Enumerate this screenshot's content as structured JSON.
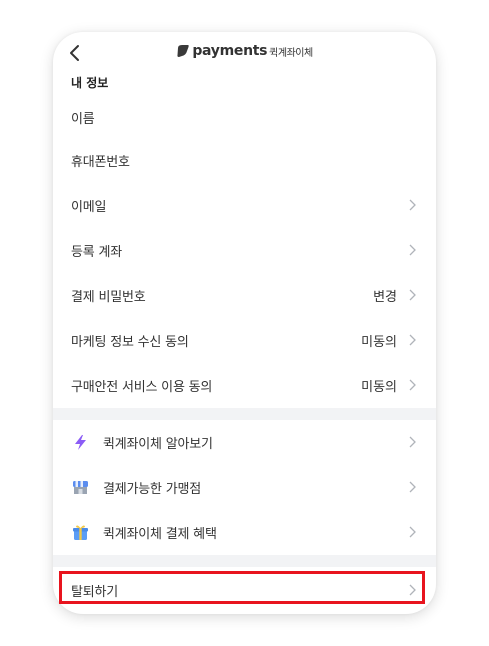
{
  "header": {
    "back_icon": "chevron-left-icon",
    "brand_word": "payments",
    "brand_sub": "퀵계좌이체"
  },
  "section_title": "내 정보",
  "info_rows": [
    {
      "label": "이름",
      "value": "",
      "chevron": false
    },
    {
      "label": "휴대폰번호",
      "value": "",
      "chevron": false
    },
    {
      "label": "이메일",
      "value": "",
      "chevron": true
    },
    {
      "label": "등록 계좌",
      "value": "",
      "chevron": true
    },
    {
      "label": "결제 비밀번호",
      "value": "변경",
      "chevron": true
    },
    {
      "label": "마케팅 정보 수신 동의",
      "value": "미동의",
      "chevron": true
    },
    {
      "label": "구매안전 서비스 이용 동의",
      "value": "미동의",
      "chevron": true
    }
  ],
  "service_rows": [
    {
      "label": "퀵계좌이체 알아보기",
      "icon": "lightning-icon"
    },
    {
      "label": "결제가능한 가맹점",
      "icon": "store-icon"
    },
    {
      "label": "퀵계좌이체 결제 혜택",
      "icon": "gift-icon"
    }
  ],
  "withdraw": {
    "label": "탈퇴하기"
  },
  "colors": {
    "highlight": "#e8141e",
    "divider": "#f2f3f5",
    "lightning": "#8b5cf6",
    "chevron": "#b0b4ba"
  }
}
